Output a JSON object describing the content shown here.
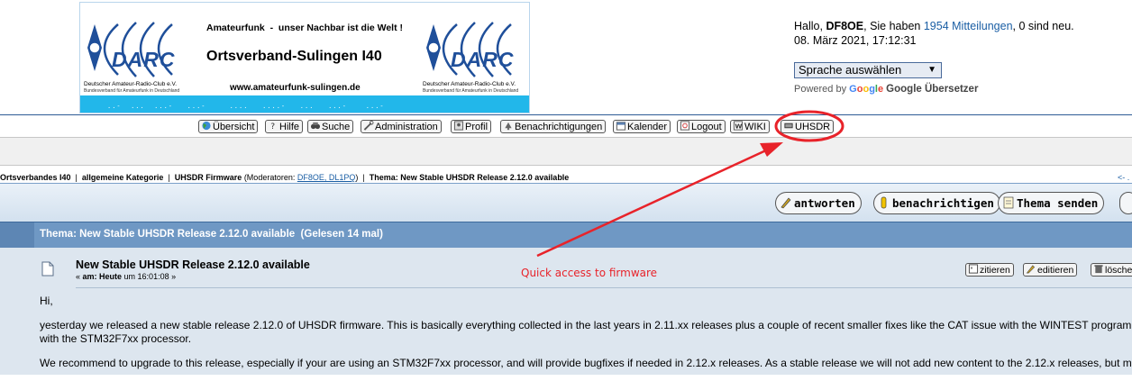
{
  "banner": {
    "tagline": "Amateurfunk  -  unser Nachbar ist die Welt !",
    "title": "Ortsverband-Sulingen I40",
    "url": "www.amateurfunk-sulingen.de",
    "logo_word": "DARC",
    "logo_club": "Deutscher Amateur-Radio-Club e.V.",
    "logo_sub": "Bundesverband für Amateurfunk in Deutschland",
    "dots": "..-  ...  ...-   ...-     ....   ....-   ...   ...-    ...-",
    "brand_color": "#22b7ea"
  },
  "user": {
    "greeting": "Hallo, ",
    "name": "DF8OE",
    "messages_prefix": ", Sie haben ",
    "messages_link": "1954 Mitteilungen",
    "messages_suffix": ", 0 sind neu.",
    "datetime": "08. März 2021, 17:12:31"
  },
  "translate": {
    "select_value": "Sprache auswählen",
    "powered_by": "Powered by ",
    "google": [
      "G",
      "o",
      "o",
      "g",
      "l",
      "e"
    ],
    "translator": "Google Übersetzer"
  },
  "nav": {
    "items": [
      {
        "label": "Übersicht",
        "icon": "globe-icon"
      },
      {
        "label": "Hilfe",
        "icon": "question-icon"
      },
      {
        "label": "Suche",
        "icon": "binoculars-icon"
      },
      {
        "label": "Administration",
        "icon": "tools-icon"
      },
      {
        "label": "Profil",
        "icon": "profile-icon"
      },
      {
        "label": "Benachrichtigungen",
        "icon": "bell-icon"
      },
      {
        "label": "Kalender",
        "icon": "calendar-icon"
      },
      {
        "label": "Logout",
        "icon": "logout-icon"
      },
      {
        "label": "WIKI",
        "icon": "wiki-icon"
      },
      {
        "label": "UHSDR",
        "icon": "chip-icon"
      }
    ]
  },
  "breadcrumb": {
    "part1": "Ortsverbandes I40",
    "sep": "  |  ",
    "part2": "allgemeine Kategorie",
    "part3": "UHSDR Firmware",
    "moderators_prefix": " (Moderatoren: ",
    "moderators": "DF8OE, DL1PQ",
    "moderators_suffix": ")",
    "part4": "Thema: New Stable UHSDR Release 2.12.0 available",
    "right": "<- ."
  },
  "actions": {
    "reply": "antworten",
    "notify": "benachrichtigen",
    "send_topic": "Thema senden"
  },
  "topic": {
    "header": "Thema: New Stable UHSDR Release 2.12.0 available  (Gelesen 14 mal)"
  },
  "post": {
    "title": "New Stable UHSDR Release 2.12.0 available",
    "date_prefix": "« ",
    "date_label": "am:",
    "date_value": " Heute",
    "date_suffix": " um 16:01:08 »",
    "buttons": {
      "quote": "zitieren",
      "edit": "editieren",
      "delete": "lösche"
    },
    "body": [
      "Hi,",
      "yesterday we released a new stable release 2.12.0 of UHSDR firmware. This is basically everything collected in the last years in 2.11.xx releases plus a couple of recent smaller fixes like the CAT issue with the WINTEST program",
      "with the STM32F7xx processor.",
      "We recommend to upgrade to this release, especially if your are using an STM32F7xx processor, and will provide bugfixes if needed in 2.12.x releases. As a stable release we will not add new content to the 2.12.x releases, but m"
    ]
  },
  "annotation": {
    "text": "Quick access to firmware",
    "color": "#e8232a"
  }
}
